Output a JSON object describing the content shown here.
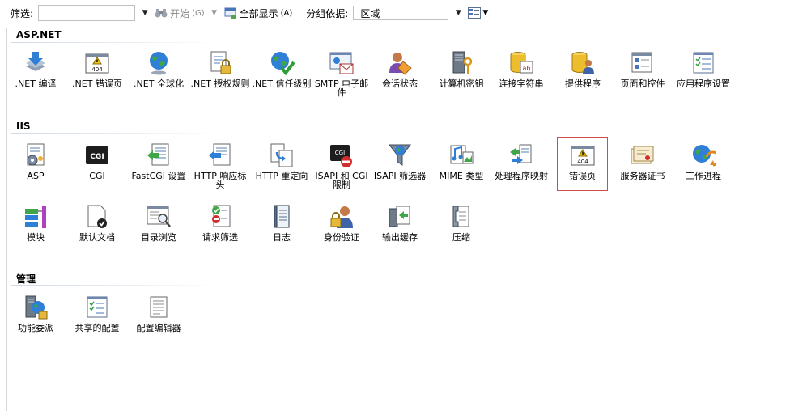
{
  "toolbar": {
    "filter_label": "筛选:",
    "filter_value": "",
    "start_label": "开始",
    "start_shortcut": "(G)",
    "show_all_label": "全部显示",
    "show_all_shortcut": "(A)",
    "group_label": "分组依据:",
    "group_value": "区域"
  },
  "sections": [
    {
      "title": "ASP.NET",
      "items": [
        {
          "label": ".NET 编译",
          "icon": "download-arrow-icon"
        },
        {
          "label": ".NET 错误页",
          "icon": "error-404-icon"
        },
        {
          "label": ".NET 全球化",
          "icon": "globe-icon"
        },
        {
          "label": ".NET 授权规则",
          "icon": "document-lock-icon"
        },
        {
          "label": ".NET 信任级别",
          "icon": "globe-check-icon"
        },
        {
          "label": "SMTP 电子邮件",
          "icon": "email-icon"
        },
        {
          "label": "会话状态",
          "icon": "user-session-icon"
        },
        {
          "label": "计算机密钥",
          "icon": "server-key-icon"
        },
        {
          "label": "连接字符串",
          "icon": "connection-string-icon"
        },
        {
          "label": "提供程序",
          "icon": "provider-icon"
        },
        {
          "label": "页面和控件",
          "icon": "pages-controls-icon"
        },
        {
          "label": "应用程序设置",
          "icon": "app-settings-icon"
        }
      ]
    },
    {
      "title": "IIS",
      "items": [
        {
          "label": "ASP",
          "icon": "asp-gear-icon"
        },
        {
          "label": "CGI",
          "icon": "cgi-icon"
        },
        {
          "label": "FastCGI 设置",
          "icon": "fastcgi-icon"
        },
        {
          "label": "HTTP 响应标头",
          "icon": "http-headers-icon"
        },
        {
          "label": "HTTP 重定向",
          "icon": "redirect-icon"
        },
        {
          "label": "ISAPI 和 CGI 限制",
          "icon": "isapi-restriction-icon"
        },
        {
          "label": "ISAPI 筛选器",
          "icon": "isapi-filter-icon"
        },
        {
          "label": "MIME 类型",
          "icon": "mime-icon"
        },
        {
          "label": "处理程序映射",
          "icon": "handler-mapping-icon"
        },
        {
          "label": "错误页",
          "icon": "error-404-icon",
          "selected": true
        },
        {
          "label": "服务器证书",
          "icon": "certificate-icon"
        },
        {
          "label": "工作进程",
          "icon": "worker-process-icon"
        },
        {
          "label": "模块",
          "icon": "modules-icon"
        },
        {
          "label": "默认文档",
          "icon": "default-document-icon"
        },
        {
          "label": "目录浏览",
          "icon": "directory-browse-icon"
        },
        {
          "label": "请求筛选",
          "icon": "request-filter-icon"
        },
        {
          "label": "日志",
          "icon": "log-icon"
        },
        {
          "label": "身份验证",
          "icon": "authentication-icon"
        },
        {
          "label": "输出缓存",
          "icon": "output-cache-icon"
        },
        {
          "label": "压缩",
          "icon": "compression-icon"
        }
      ]
    },
    {
      "title": "管理",
      "items": [
        {
          "label": "功能委派",
          "icon": "feature-delegation-icon"
        },
        {
          "label": "共享的配置",
          "icon": "shared-config-icon"
        },
        {
          "label": "配置编辑器",
          "icon": "config-editor-icon"
        }
      ]
    }
  ],
  "colors": {
    "selection_border": "#d24b4b",
    "section_line": "#cfd8e6"
  }
}
